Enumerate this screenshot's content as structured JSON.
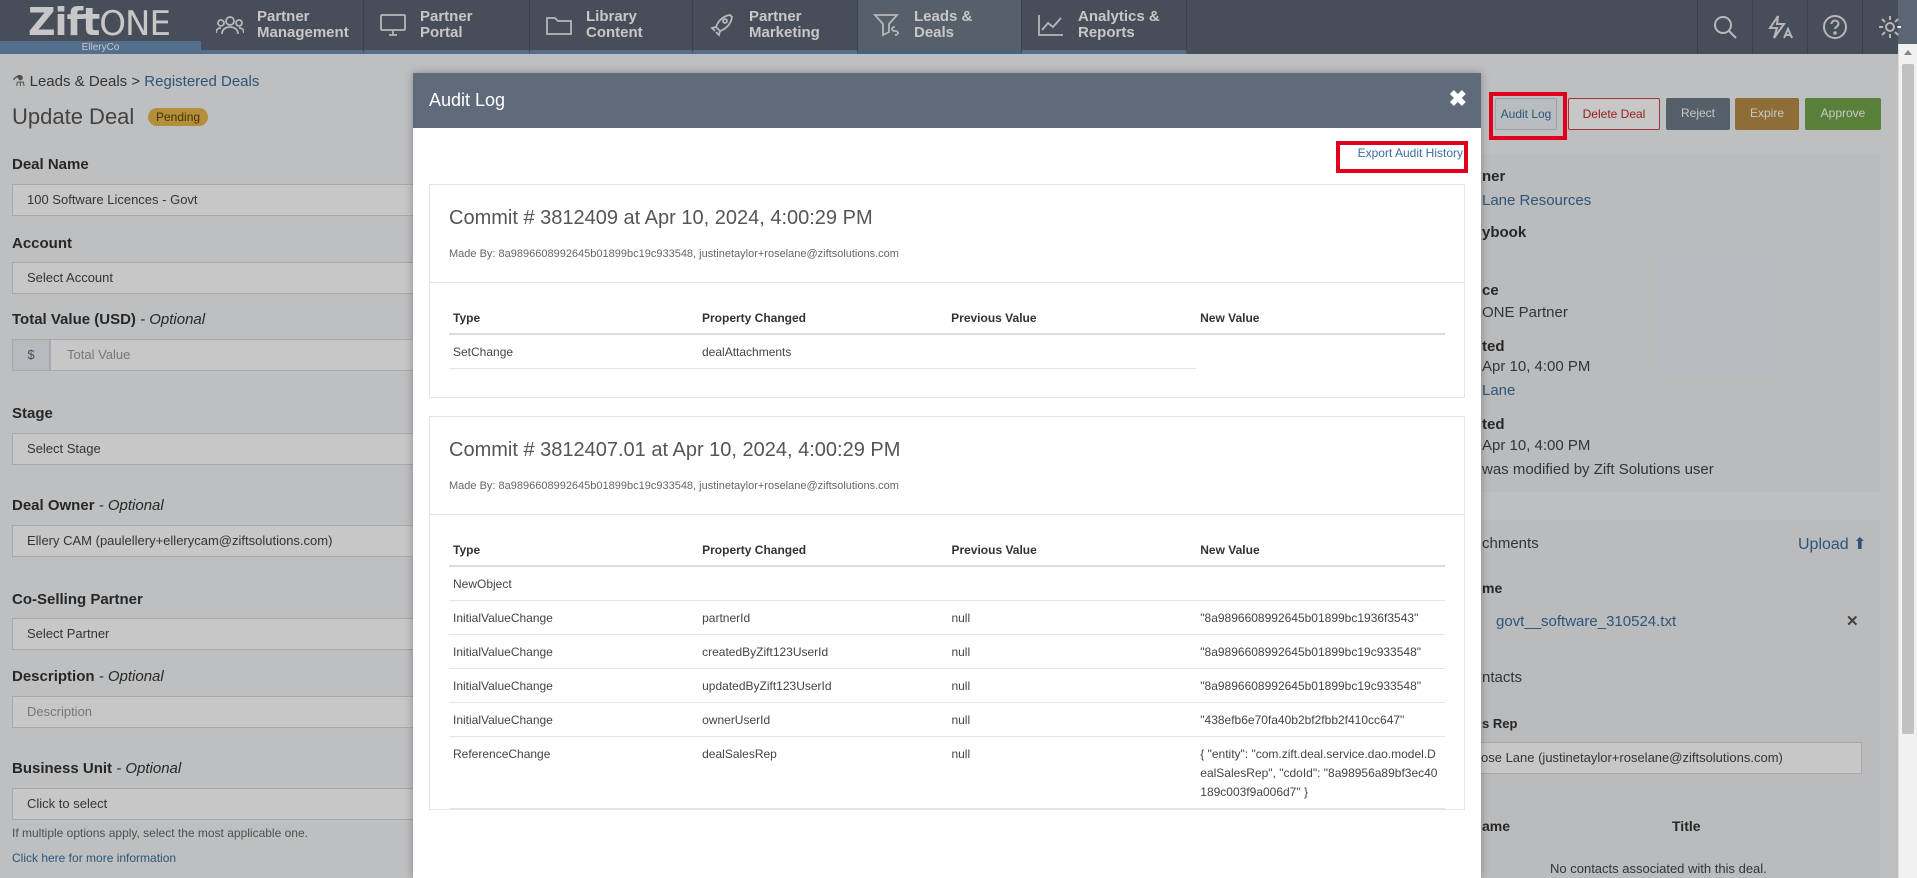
{
  "brand": {
    "logo_bold": "Zift",
    "logo_light": "ONE",
    "org": "ElleryCo"
  },
  "nav": {
    "items": [
      {
        "label_line1": "Partner",
        "label_line2": "Management",
        "icon": "users-icon"
      },
      {
        "label_line1": "Partner",
        "label_line2": "Portal",
        "icon": "monitor-icon"
      },
      {
        "label_line1": "Library",
        "label_line2": "Content",
        "icon": "folder-icon"
      },
      {
        "label_line1": "Partner",
        "label_line2": "Marketing",
        "icon": "rocket-icon"
      },
      {
        "label_line1": "Leads &",
        "label_line2": "Deals",
        "icon": "funnel-dollar-icon"
      },
      {
        "label_line1": "Analytics &",
        "label_line2": "Reports",
        "icon": "chart-line-icon"
      }
    ],
    "active": "Leads & Deals",
    "right_icons": [
      "search-icon",
      "bolt-text-icon",
      "help-icon",
      "gear-icon"
    ]
  },
  "page": {
    "breadcrumb_root": "Leads & Deals",
    "breadcrumb_sep": ">",
    "breadcrumb_link": "Registered Deals",
    "title": "Update Deal",
    "status": "Pending",
    "fields": {
      "deal_name_label": "Deal Name",
      "deal_name_value": "100 Software Licences - Govt",
      "account_label": "Account",
      "account_value": "Select Account",
      "total_value_label": "Total Value (USD)",
      "total_value_optional": "- Optional",
      "currency_symbol": "$",
      "total_value_placeholder": "Total Value",
      "stage_label": "Stage",
      "stage_value": "Select Stage",
      "owner_label": "Deal Owner",
      "owner_optional": "- Optional",
      "owner_value": "Ellery CAM (paulellery+ellerycam@ziftsolutions.com)",
      "cosell_label": "Co-Selling Partner",
      "cosell_value": "Select Partner",
      "description_label": "Description",
      "description_optional": "- Optional",
      "description_placeholder": "Description",
      "bu_label": "Business Unit",
      "bu_optional": "- Optional",
      "bu_value": "Click to select",
      "bu_hint": "If multiple options apply, select the most applicable one.",
      "bu_link": "Click here for more information"
    },
    "actions": {
      "audit_log": "Audit Log",
      "delete": "Delete Deal",
      "reject": "Reject",
      "expire": "Expire",
      "approve": "Approve"
    },
    "side": {
      "owner_label": "ner",
      "owner_value": "Lane Resources",
      "playbook_label": "ybook",
      "source_label": "ce",
      "source_value": "ONE Partner",
      "created_label": "ted",
      "created_value": "Apr 10, 4:00 PM",
      "created_by": "Lane",
      "updated_label": "ted",
      "updated_value": "Apr 10, 4:00 PM",
      "updated_note": "was modified by Zift Solutions user",
      "attachments_label": "chments",
      "upload": "Upload",
      "name_col": "me",
      "file": "govt__software_310524.txt",
      "contacts_label": "ntacts",
      "sales_rep_label": "s Rep",
      "sales_rep_value": "ose Lane (justinetaylor+roselane@ziftsolutions.com)",
      "contacts_name_col": "ame",
      "contacts_title_col": "Title",
      "contacts_empty": "No contacts associated with this deal."
    }
  },
  "modal": {
    "title": "Audit Log",
    "export": "Export Audit History",
    "columns": [
      "Type",
      "Property Changed",
      "Previous Value",
      "New Value"
    ],
    "commits": [
      {
        "title": "Commit # 3812409 at Apr 10, 2024, 4:00:29 PM",
        "made_by": "Made By: 8a9896608992645b01899bc19c933548, justinetaylor+roselane@ziftsolutions.com",
        "rows": [
          [
            "SetChange",
            "dealAttachments",
            "",
            ""
          ]
        ]
      },
      {
        "title": "Commit # 3812407.01 at Apr 10, 2024, 4:00:29 PM",
        "made_by": "Made By: 8a9896608992645b01899bc19c933548, justinetaylor+roselane@ziftsolutions.com",
        "rows": [
          [
            "NewObject",
            "",
            "",
            ""
          ],
          [
            "InitialValueChange",
            "partnerId",
            "null",
            "\"8a9896608992645b01899bc1936f3543\""
          ],
          [
            "InitialValueChange",
            "createdByZift123UserId",
            "null",
            "\"8a9896608992645b01899bc19c933548\""
          ],
          [
            "InitialValueChange",
            "updatedByZift123UserId",
            "null",
            "\"8a9896608992645b01899bc19c933548\""
          ],
          [
            "InitialValueChange",
            "ownerUserId",
            "null",
            "\"438efb6e70fa40b2bf2fbb2f410cc647\""
          ],
          [
            "ReferenceChange",
            "dealSalesRep",
            "null",
            "{ \"entity\": \"com.zift.deal.service.dao.model.DealSalesRep\", \"cdoId\": \"8a98956a89bf3ec40189c003f9a006d7\" }"
          ]
        ]
      }
    ]
  }
}
